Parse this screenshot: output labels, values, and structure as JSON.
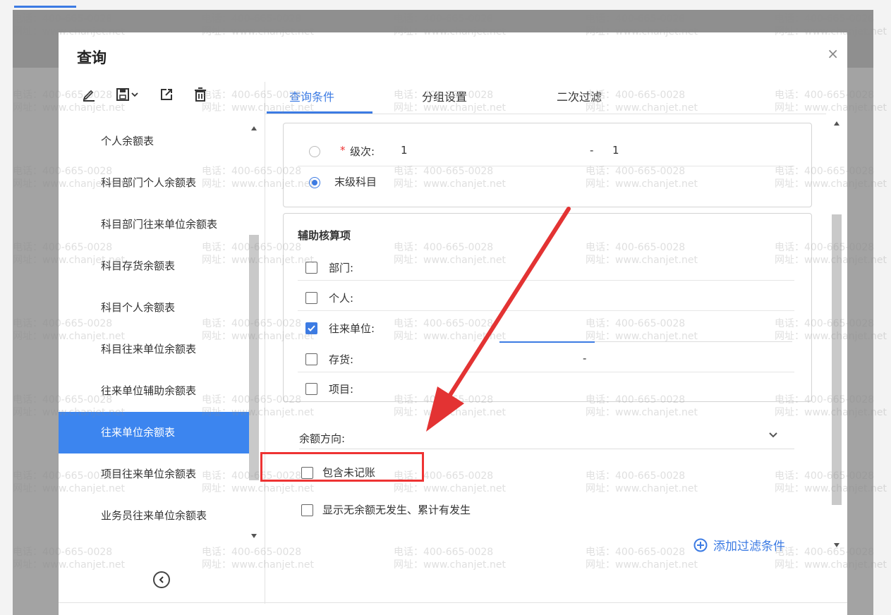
{
  "watermark": {
    "phone": "电话：400-665-0028",
    "site": "网址：www.chanjet.net"
  },
  "dialog": {
    "title": "查询",
    "close_label": "×"
  },
  "toolbar": {
    "edit_icon": "pencil-icon",
    "save_icon": "save-icon",
    "export_icon": "export-icon",
    "delete_icon": "trash-icon"
  },
  "left_list": {
    "items": [
      {
        "label": "个人余额表"
      },
      {
        "label": "科目部门个人余额表"
      },
      {
        "label": "科目部门往来单位余额表"
      },
      {
        "label": "科目存货余额表"
      },
      {
        "label": "科目个人余额表"
      },
      {
        "label": "科目往来单位余额表"
      },
      {
        "label": "往来单位辅助余额表"
      },
      {
        "label": "往来单位余额表"
      },
      {
        "label": "项目往来单位余额表"
      },
      {
        "label": "业务员往来单位余额表"
      }
    ],
    "selected": "往来单位余额表",
    "collapse_icon": "collapse-left-icon"
  },
  "tabs": [
    {
      "label": "查询条件"
    },
    {
      "label": "分组设置"
    },
    {
      "label": "二次过滤"
    }
  ],
  "active_tab": "查询条件",
  "level": {
    "required_mark": "*",
    "label": "级次:",
    "from": "1",
    "separator": "-",
    "to": "1",
    "last_level_label": "末级科目",
    "last_level_checked": true
  },
  "aux": {
    "title": "辅助核算项",
    "items": [
      {
        "label": "部门:",
        "checked": false
      },
      {
        "label": "个人:",
        "checked": false
      },
      {
        "label": "往来单位:",
        "checked": true
      },
      {
        "label": "存货:",
        "checked": false,
        "value": "-"
      },
      {
        "label": "项目:",
        "checked": false
      }
    ]
  },
  "balance_direction": {
    "label": "余额方向:"
  },
  "options": {
    "include_unposted": {
      "label": "包含未记账",
      "checked": false
    },
    "show_no_balance": {
      "label": "显示无余额无发生、累计有发生",
      "checked": false
    }
  },
  "add_filter": {
    "label": "添加过滤条件",
    "icon": "plus-circle-icon"
  },
  "annotation": {
    "color": "#e33333"
  }
}
